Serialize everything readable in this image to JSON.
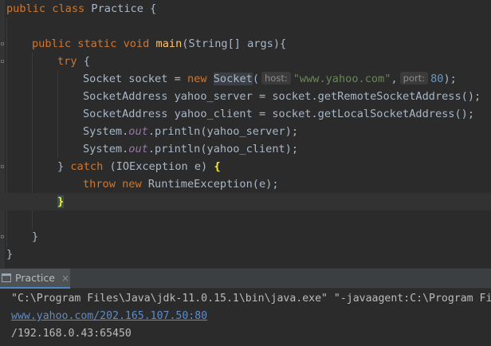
{
  "editor": {
    "lines": {
      "l1": {
        "kw1": "public",
        "kw2": "class",
        "name": "Practice",
        "brace": "{"
      },
      "l3": {
        "kw1": "public",
        "kw2": "static",
        "kw3": "void",
        "method": "main",
        "params": "(String[] args){"
      },
      "l4": {
        "kw": "try",
        "brace": "{"
      },
      "l5": {
        "a": "Socket socket = ",
        "kw": "new",
        "cls": "Socket",
        "paren": "(",
        "hint_host": "host:",
        "str": "\"www.yahoo.com\"",
        "comma": ",",
        "hint_port": "port:",
        "num": "80",
        "end": ");"
      },
      "l6": {
        "text": "SocketAddress yahoo_server = socket.getRemoteSocketAddress();"
      },
      "l7": {
        "text": "SocketAddress yahoo_client = socket.getLocalSocketAddress();"
      },
      "l8": {
        "a": "System.",
        "field": "out",
        "b": ".println(yahoo_server);"
      },
      "l9": {
        "a": "System.",
        "field": "out",
        "b": ".println(yahoo_client);"
      },
      "l10": {
        "a": "} ",
        "kw": "catch",
        "b": " (IOException e) ",
        "brace": "{"
      },
      "l11": {
        "kw1": "throw",
        "kw2": "new",
        "b": " RuntimeException(e);"
      },
      "l12": {
        "brace": "}"
      },
      "l14": {
        "text": "}"
      },
      "l15": {
        "text": "}"
      }
    }
  },
  "run_panel": {
    "tab_label": "Practice",
    "tab_close": "×",
    "output": [
      "\"C:\\Program Files\\Java\\jdk-11.0.15.1\\bin\\java.exe\" \"-javaagent:C:\\Program Fi",
      "www.yahoo.com/202.165.107.50:80",
      "/192.168.0.43:65450"
    ]
  },
  "colors": {
    "background": "#2b2b2b",
    "keyword": "#cc7832",
    "method": "#ffc66d",
    "string": "#6a8759",
    "number": "#6897bb",
    "static_field": "#9876aa",
    "link": "#5f8cc9"
  },
  "icons": {
    "tab_icon": "console-window-icon"
  }
}
